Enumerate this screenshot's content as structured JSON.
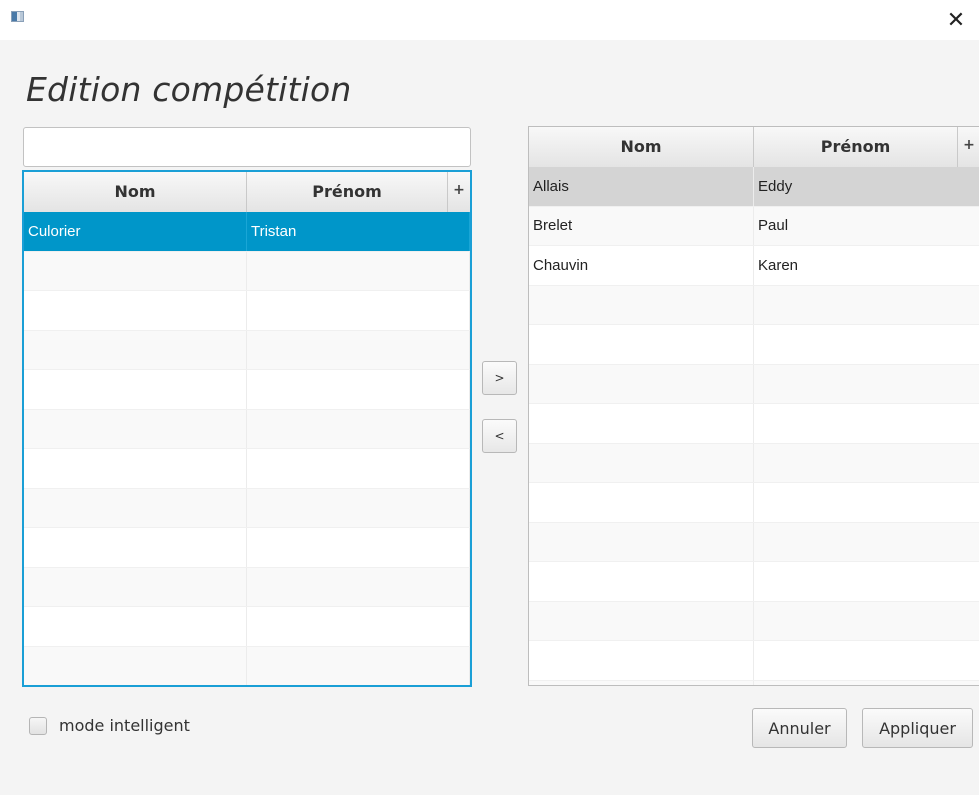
{
  "window": {
    "close_glyph": "✕"
  },
  "page_title": "Edition compétition",
  "search": {
    "value": "",
    "placeholder": ""
  },
  "left_table": {
    "columns": [
      "Nom",
      "Prénom"
    ],
    "menu_button": "+",
    "rows": [
      [
        "Culorier",
        "Tristan"
      ],
      [
        "",
        ""
      ],
      [
        "",
        ""
      ],
      [
        "",
        ""
      ],
      [
        "",
        ""
      ],
      [
        "",
        ""
      ],
      [
        "",
        ""
      ],
      [
        "",
        ""
      ],
      [
        "",
        ""
      ],
      [
        "",
        ""
      ],
      [
        "",
        ""
      ],
      [
        "",
        ""
      ]
    ],
    "selected_index": 0
  },
  "right_table": {
    "columns": [
      "Nom",
      "Prénom"
    ],
    "menu_button": "+",
    "rows": [
      [
        "Allais",
        "Eddy"
      ],
      [
        "Brelet",
        "Paul"
      ],
      [
        "Chauvin",
        "Karen"
      ],
      [
        "",
        ""
      ],
      [
        "",
        ""
      ],
      [
        "",
        ""
      ],
      [
        "",
        ""
      ],
      [
        "",
        ""
      ],
      [
        "",
        ""
      ],
      [
        "",
        ""
      ],
      [
        "",
        ""
      ],
      [
        "",
        ""
      ],
      [
        "",
        ""
      ],
      [
        "",
        ""
      ]
    ],
    "focused_index": 0
  },
  "transfer": {
    "add": ">",
    "remove": "<"
  },
  "smart_mode": {
    "label": "mode intelligent",
    "checked": false
  },
  "buttons": {
    "cancel": "Annuler",
    "apply": "Appliquer"
  },
  "colors": {
    "selection": "#0096c9",
    "focus_border": "#1a9fd6",
    "background": "#f4f4f4"
  }
}
